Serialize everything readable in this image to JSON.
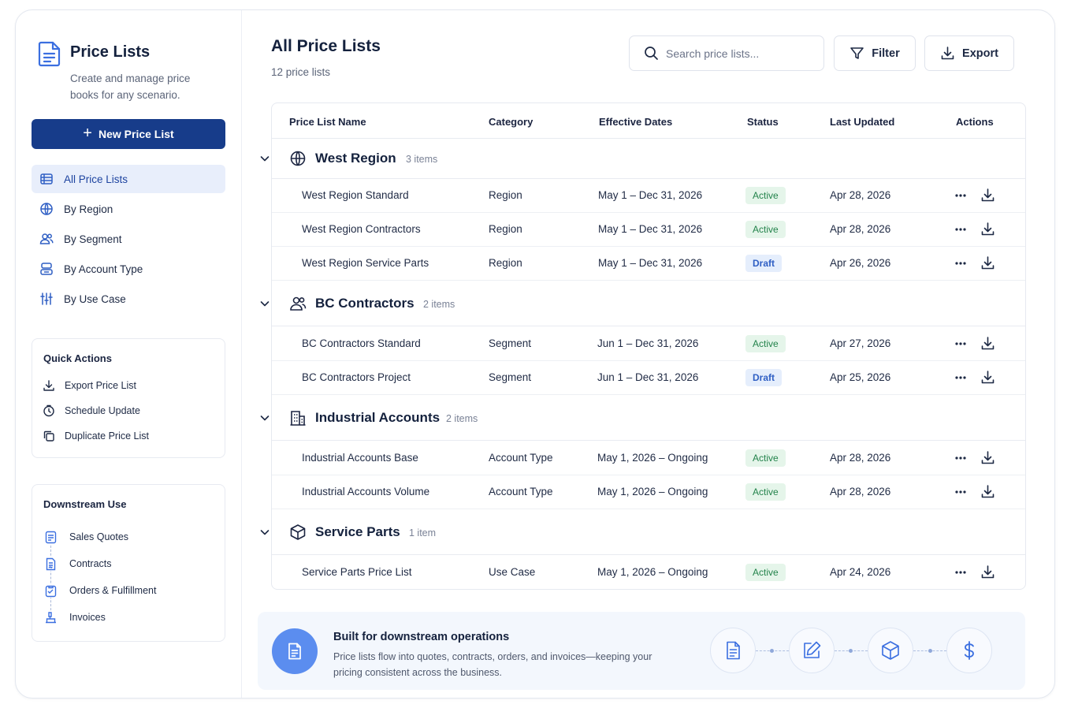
{
  "sidebar": {
    "title": "Price Lists",
    "description": "Create and manage price books for any scenario.",
    "new_button": "New Price List",
    "nav": [
      {
        "label": "All Price Lists",
        "icon": "list-icon"
      },
      {
        "label": "By Region",
        "icon": "globe-icon"
      },
      {
        "label": "By Segment",
        "icon": "users-icon"
      },
      {
        "label": "By Account Type",
        "icon": "account-icon"
      },
      {
        "label": "By Use Case",
        "icon": "sliders-icon"
      }
    ],
    "quick_actions": {
      "title": "Quick Actions",
      "items": [
        {
          "label": "Export Price List",
          "icon": "download-icon"
        },
        {
          "label": "Schedule Update",
          "icon": "clock-icon"
        },
        {
          "label": "Duplicate Price List",
          "icon": "duplicate-icon"
        }
      ]
    },
    "downstream": {
      "title": "Downstream Use",
      "items": [
        {
          "label": "Sales Quotes",
          "icon": "quote-icon"
        },
        {
          "label": "Contracts",
          "icon": "contract-icon"
        },
        {
          "label": "Orders & Fulfillment",
          "icon": "order-icon"
        },
        {
          "label": "Invoices",
          "icon": "invoice-icon"
        }
      ]
    }
  },
  "header": {
    "title": "All Price Lists",
    "subtitle": "12 price lists",
    "search_placeholder": "Search price lists...",
    "filter_label": "Filter",
    "export_label": "Export"
  },
  "table": {
    "columns": [
      "Price List Name",
      "Category",
      "Effective Dates",
      "Status",
      "Last Updated",
      "Actions"
    ],
    "groups": [
      {
        "name": "West Region",
        "count": "3 items",
        "icon": "globe-icon",
        "rows": [
          {
            "name": "West Region Standard",
            "category": "Region",
            "dates": "May 1 – Dec 31, 2026",
            "status": "Active",
            "updated": "Apr 28, 2026"
          },
          {
            "name": "West Region Contractors",
            "category": "Region",
            "dates": "May 1 – Dec 31, 2026",
            "status": "Active",
            "updated": "Apr 28, 2026"
          },
          {
            "name": "West Region Service Parts",
            "category": "Region",
            "dates": "May 1 – Dec 31, 2026",
            "status": "Draft",
            "updated": "Apr 26, 2026"
          }
        ]
      },
      {
        "name": "BC Contractors",
        "count": "2 items",
        "icon": "users-icon",
        "rows": [
          {
            "name": "BC Contractors Standard",
            "category": "Segment",
            "dates": "Jun 1 – Dec 31, 2026",
            "status": "Active",
            "updated": "Apr 27, 2026"
          },
          {
            "name": "BC Contractors Project",
            "category": "Segment",
            "dates": "Jun 1 – Dec 31, 2026",
            "status": "Draft",
            "updated": "Apr 25, 2026"
          }
        ]
      },
      {
        "name": "Industrial Accounts",
        "count": "2 items",
        "icon": "building-icon",
        "rows": [
          {
            "name": "Industrial Accounts Base",
            "category": "Account Type",
            "dates": "May 1, 2026 – Ongoing",
            "status": "Active",
            "updated": "Apr 28, 2026"
          },
          {
            "name": "Industrial Accounts Volume",
            "category": "Account Type",
            "dates": "May 1, 2026 – Ongoing",
            "status": "Active",
            "updated": "Apr 28, 2026"
          }
        ]
      },
      {
        "name": "Service Parts",
        "count": "1 item",
        "icon": "box-icon",
        "rows": [
          {
            "name": "Service Parts Price List",
            "category": "Use Case",
            "dates": "May 1, 2026 – Ongoing",
            "status": "Active",
            "updated": "Apr 24, 2026"
          }
        ]
      }
    ]
  },
  "banner": {
    "title": "Built for downstream operations",
    "text": "Price lists flow into quotes, contracts, orders, and invoices—keeping your pricing consistent across the business.",
    "flow_icons": [
      "document-icon",
      "edit-icon",
      "box-icon",
      "dollar-icon"
    ]
  },
  "colors": {
    "primary": "#173c8a",
    "accent": "#1e44a0",
    "active_bg": "#e5f5ea",
    "active_text": "#23834b",
    "draft_bg": "#e5eefc",
    "draft_text": "#2f5fc4"
  }
}
